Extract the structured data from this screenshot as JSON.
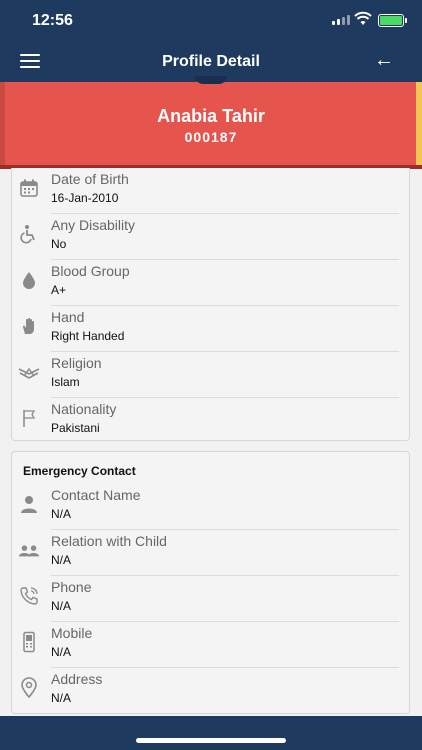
{
  "status_bar": {
    "time": "12:56",
    "battery_color": "#4cd964"
  },
  "nav": {
    "title": "Profile Detail",
    "menu_icon": "hamburger-icon",
    "back_icon": "arrow-left-icon"
  },
  "profile": {
    "name": "Anabia Tahir",
    "code": "000187"
  },
  "personal_details": [
    {
      "icon": "calendar-icon",
      "label": "Date of Birth",
      "value": "16-Jan-2010"
    },
    {
      "icon": "wheelchair-icon",
      "label": "Any Disability",
      "value": "No"
    },
    {
      "icon": "blood-drop-icon",
      "label": "Blood Group",
      "value": "A+"
    },
    {
      "icon": "hand-icon",
      "label": "Hand",
      "value": "Right Handed"
    },
    {
      "icon": "book-icon",
      "label": "Religion",
      "value": "Islam"
    },
    {
      "icon": "flag-icon",
      "label": "Nationality",
      "value": "Pakistani"
    }
  ],
  "emergency": {
    "heading": "Emergency Contact",
    "items": [
      {
        "icon": "person-icon",
        "label": "Contact Name",
        "value": "N/A"
      },
      {
        "icon": "people-icon",
        "label": "Relation with Child",
        "value": "N/A"
      },
      {
        "icon": "phone-icon",
        "label": "Phone",
        "value": "N/A"
      },
      {
        "icon": "mobile-icon",
        "label": "Mobile",
        "value": "N/A"
      },
      {
        "icon": "location-pin-icon",
        "label": "Address",
        "value": "N/A"
      }
    ]
  },
  "colors": {
    "header": "#1f3a5f",
    "banner": "#e5554d",
    "banner_border": "#9b2d2d",
    "icon": "#8a8a8a"
  }
}
